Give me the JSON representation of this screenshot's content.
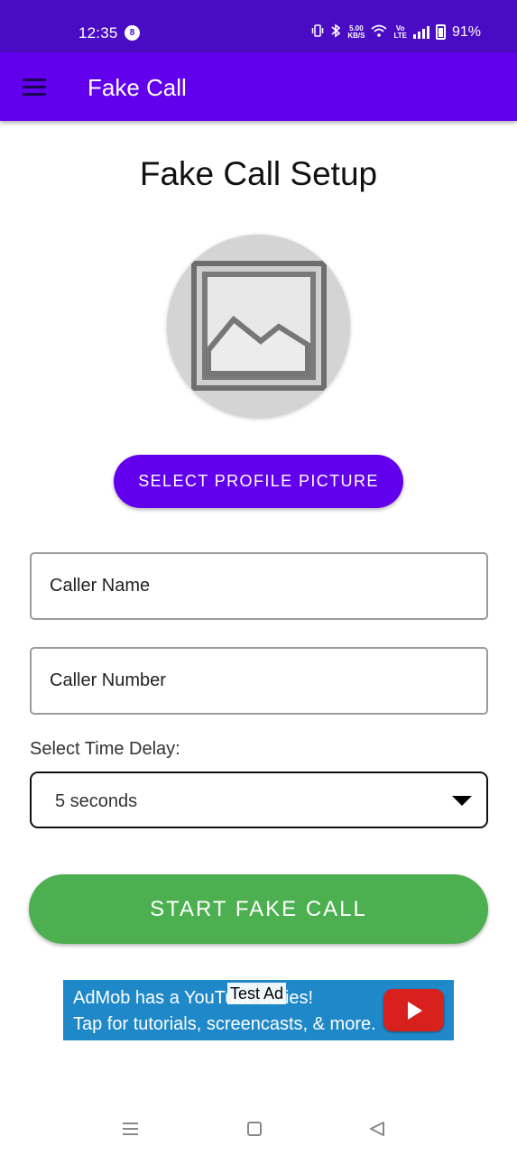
{
  "status_bar": {
    "time": "12:35",
    "notification_count": "8",
    "network_speed_value": "5.00",
    "network_speed_unit": "KB/S",
    "volte_line1": "Vo",
    "volte_line2": "LTE",
    "battery_percent": "91%",
    "icons": [
      "vibrate-icon",
      "bluetooth-icon",
      "wifi-icon",
      "volte-icon",
      "signal-icon",
      "battery-icon"
    ]
  },
  "app_bar": {
    "title": "Fake Call",
    "menu_icon": "hamburger-menu-icon"
  },
  "main": {
    "heading": "Fake Call Setup",
    "avatar_icon": "image-placeholder-icon",
    "select_picture_label": "SELECT PROFILE PICTURE",
    "caller_name_placeholder": "Caller Name",
    "caller_number_placeholder": "Caller Number",
    "delay_label": "Select Time Delay:",
    "delay_value": "5 seconds",
    "start_label": "START FAKE CALL"
  },
  "ad": {
    "line1": "AdMob has a YouTube series!",
    "line2": "Tap for tutorials, screencasts, & more.",
    "badge": "Test Ad",
    "icon": "youtube-play-icon"
  },
  "nav_bar": {
    "icons": [
      "recents-menu-icon",
      "home-icon",
      "back-icon"
    ]
  },
  "colors": {
    "status_bar": "#4a0bc4",
    "app_bar": "#6200ee",
    "primary_button": "#6200ee",
    "start_button": "#4caf50",
    "ad_background": "#1e88c8"
  }
}
